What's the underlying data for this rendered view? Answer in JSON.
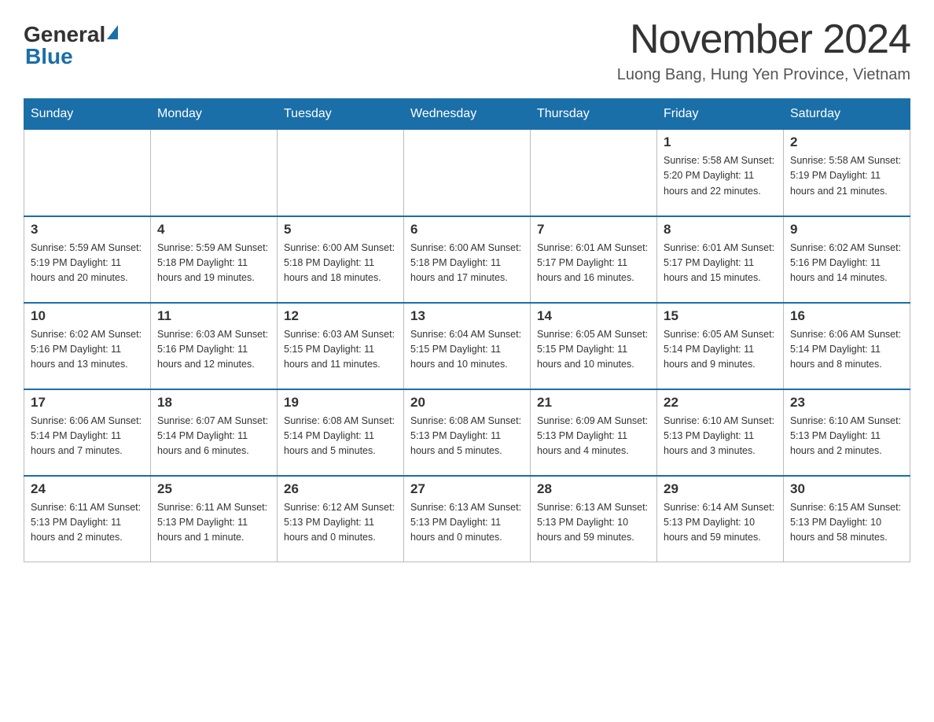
{
  "header": {
    "logo_general": "General",
    "logo_blue": "Blue",
    "month_title": "November 2024",
    "location": "Luong Bang, Hung Yen Province, Vietnam"
  },
  "weekdays": [
    "Sunday",
    "Monday",
    "Tuesday",
    "Wednesday",
    "Thursday",
    "Friday",
    "Saturday"
  ],
  "weeks": [
    [
      {
        "day": "",
        "info": ""
      },
      {
        "day": "",
        "info": ""
      },
      {
        "day": "",
        "info": ""
      },
      {
        "day": "",
        "info": ""
      },
      {
        "day": "",
        "info": ""
      },
      {
        "day": "1",
        "info": "Sunrise: 5:58 AM\nSunset: 5:20 PM\nDaylight: 11 hours and 22 minutes."
      },
      {
        "day": "2",
        "info": "Sunrise: 5:58 AM\nSunset: 5:19 PM\nDaylight: 11 hours and 21 minutes."
      }
    ],
    [
      {
        "day": "3",
        "info": "Sunrise: 5:59 AM\nSunset: 5:19 PM\nDaylight: 11 hours and 20 minutes."
      },
      {
        "day": "4",
        "info": "Sunrise: 5:59 AM\nSunset: 5:18 PM\nDaylight: 11 hours and 19 minutes."
      },
      {
        "day": "5",
        "info": "Sunrise: 6:00 AM\nSunset: 5:18 PM\nDaylight: 11 hours and 18 minutes."
      },
      {
        "day": "6",
        "info": "Sunrise: 6:00 AM\nSunset: 5:18 PM\nDaylight: 11 hours and 17 minutes."
      },
      {
        "day": "7",
        "info": "Sunrise: 6:01 AM\nSunset: 5:17 PM\nDaylight: 11 hours and 16 minutes."
      },
      {
        "day": "8",
        "info": "Sunrise: 6:01 AM\nSunset: 5:17 PM\nDaylight: 11 hours and 15 minutes."
      },
      {
        "day": "9",
        "info": "Sunrise: 6:02 AM\nSunset: 5:16 PM\nDaylight: 11 hours and 14 minutes."
      }
    ],
    [
      {
        "day": "10",
        "info": "Sunrise: 6:02 AM\nSunset: 5:16 PM\nDaylight: 11 hours and 13 minutes."
      },
      {
        "day": "11",
        "info": "Sunrise: 6:03 AM\nSunset: 5:16 PM\nDaylight: 11 hours and 12 minutes."
      },
      {
        "day": "12",
        "info": "Sunrise: 6:03 AM\nSunset: 5:15 PM\nDaylight: 11 hours and 11 minutes."
      },
      {
        "day": "13",
        "info": "Sunrise: 6:04 AM\nSunset: 5:15 PM\nDaylight: 11 hours and 10 minutes."
      },
      {
        "day": "14",
        "info": "Sunrise: 6:05 AM\nSunset: 5:15 PM\nDaylight: 11 hours and 10 minutes."
      },
      {
        "day": "15",
        "info": "Sunrise: 6:05 AM\nSunset: 5:14 PM\nDaylight: 11 hours and 9 minutes."
      },
      {
        "day": "16",
        "info": "Sunrise: 6:06 AM\nSunset: 5:14 PM\nDaylight: 11 hours and 8 minutes."
      }
    ],
    [
      {
        "day": "17",
        "info": "Sunrise: 6:06 AM\nSunset: 5:14 PM\nDaylight: 11 hours and 7 minutes."
      },
      {
        "day": "18",
        "info": "Sunrise: 6:07 AM\nSunset: 5:14 PM\nDaylight: 11 hours and 6 minutes."
      },
      {
        "day": "19",
        "info": "Sunrise: 6:08 AM\nSunset: 5:14 PM\nDaylight: 11 hours and 5 minutes."
      },
      {
        "day": "20",
        "info": "Sunrise: 6:08 AM\nSunset: 5:13 PM\nDaylight: 11 hours and 5 minutes."
      },
      {
        "day": "21",
        "info": "Sunrise: 6:09 AM\nSunset: 5:13 PM\nDaylight: 11 hours and 4 minutes."
      },
      {
        "day": "22",
        "info": "Sunrise: 6:10 AM\nSunset: 5:13 PM\nDaylight: 11 hours and 3 minutes."
      },
      {
        "day": "23",
        "info": "Sunrise: 6:10 AM\nSunset: 5:13 PM\nDaylight: 11 hours and 2 minutes."
      }
    ],
    [
      {
        "day": "24",
        "info": "Sunrise: 6:11 AM\nSunset: 5:13 PM\nDaylight: 11 hours and 2 minutes."
      },
      {
        "day": "25",
        "info": "Sunrise: 6:11 AM\nSunset: 5:13 PM\nDaylight: 11 hours and 1 minute."
      },
      {
        "day": "26",
        "info": "Sunrise: 6:12 AM\nSunset: 5:13 PM\nDaylight: 11 hours and 0 minutes."
      },
      {
        "day": "27",
        "info": "Sunrise: 6:13 AM\nSunset: 5:13 PM\nDaylight: 11 hours and 0 minutes."
      },
      {
        "day": "28",
        "info": "Sunrise: 6:13 AM\nSunset: 5:13 PM\nDaylight: 10 hours and 59 minutes."
      },
      {
        "day": "29",
        "info": "Sunrise: 6:14 AM\nSunset: 5:13 PM\nDaylight: 10 hours and 59 minutes."
      },
      {
        "day": "30",
        "info": "Sunrise: 6:15 AM\nSunset: 5:13 PM\nDaylight: 10 hours and 58 minutes."
      }
    ]
  ]
}
